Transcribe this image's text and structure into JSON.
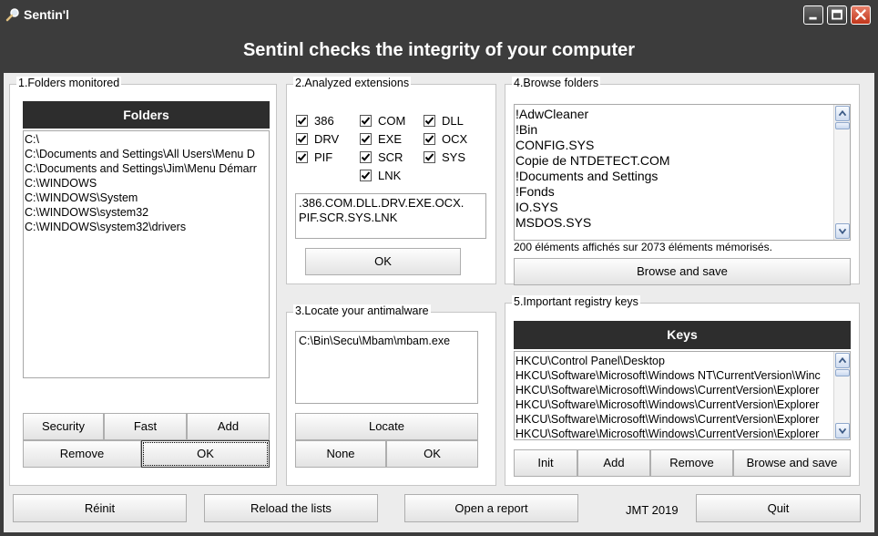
{
  "window": {
    "title": "Sentin'l",
    "header": "Sentinl checks the integrity of your computer"
  },
  "colors": {
    "titlebar": "#3c3c3c",
    "panel_header": "#2d2d2d",
    "close_button": "#c1351a"
  },
  "folders_panel": {
    "title": "1.Folders monitored",
    "header": "Folders",
    "items": [
      "C:\\",
      "C:\\Documents and Settings\\All Users\\Menu D",
      "C:\\Documents and Settings\\Jim\\Menu Démarr",
      "C:\\WINDOWS",
      "C:\\WINDOWS\\System",
      "C:\\WINDOWS\\system32",
      "C:\\WINDOWS\\system32\\drivers"
    ],
    "buttons": {
      "security": "Security",
      "fast": "Fast",
      "add": "Add",
      "remove": "Remove",
      "ok": "OK"
    }
  },
  "extensions_panel": {
    "title": "2.Analyzed extensions",
    "checkboxes": [
      {
        "label": "386",
        "checked": true
      },
      {
        "label": "COM",
        "checked": true
      },
      {
        "label": "DLL",
        "checked": true
      },
      {
        "label": "DRV",
        "checked": true
      },
      {
        "label": "EXE",
        "checked": true
      },
      {
        "label": "OCX",
        "checked": true
      },
      {
        "label": "PIF",
        "checked": true
      },
      {
        "label": "SCR",
        "checked": true
      },
      {
        "label": "SYS",
        "checked": true
      },
      {
        "label": "LNK",
        "checked": true
      }
    ],
    "extensions_text_line1": ".386.COM.DLL.DRV.EXE.OCX.",
    "extensions_text_line2": "PIF.SCR.SYS.LNK",
    "ok_label": "OK"
  },
  "antimalware_panel": {
    "title": "3.Locate your antimalware",
    "path": "C:\\Bin\\Secu\\Mbam\\mbam.exe",
    "buttons": {
      "locate": "Locate",
      "none": "None",
      "ok": "OK"
    }
  },
  "browse_panel": {
    "title": "4.Browse folders",
    "items": [
      "!AdwCleaner",
      "!Bin",
      "CONFIG.SYS",
      "Copie de NTDETECT.COM",
      "!Documents and Settings",
      "!Fonds",
      "IO.SYS",
      "MSDOS.SYS"
    ],
    "info": "200 éléments affichés sur 2073 éléments mémorisés.",
    "browse_save_label": "Browse and save"
  },
  "registry_panel": {
    "title": "5.Important registry keys",
    "header": "Keys",
    "items": [
      "HKCU\\Control Panel\\Desktop",
      "HKCU\\Software\\Microsoft\\Windows NT\\CurrentVersion\\Winc",
      "HKCU\\Software\\Microsoft\\Windows\\CurrentVersion\\Explorer",
      "HKCU\\Software\\Microsoft\\Windows\\CurrentVersion\\Explorer",
      "HKCU\\Software\\Microsoft\\Windows\\CurrentVersion\\Explorer",
      "HKCU\\Software\\Microsoft\\Windows\\CurrentVersion\\Explorer"
    ],
    "buttons": {
      "init": "Init",
      "add": "Add",
      "remove": "Remove",
      "browse_save": "Browse and save"
    }
  },
  "footer": {
    "reinit": "Réinit",
    "reload": "Reload the lists",
    "open_report": "Open a report",
    "credit": "JMT 2019",
    "quit": "Quit"
  }
}
